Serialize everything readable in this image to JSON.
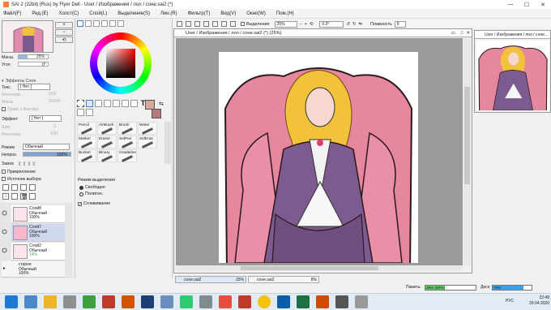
{
  "window": {
    "title": "SAI 2 (32bit) (Rus) by Flyer Dell - User / Изображения / лол / соне.sai2 (*)"
  },
  "menu": [
    "Файл(F)",
    "Ред.(E)",
    "Холст(C)",
    "Слой(L)",
    "Выделение(S)",
    "Лин.(R)",
    "Фильтр(T)",
    "Вид(V)",
    "Окно(W)",
    "Пом.(H)"
  ],
  "toolbar": {
    "selection_label": "Выделение",
    "zoom": "25%",
    "angle": "0.0°",
    "smoothing_label": "Плавность",
    "smoothing_value": "8"
  },
  "navigator": {
    "zoom_label": "Масш.",
    "zoom_value": "25%",
    "angle_label": "Угол",
    "angle_value": "0°"
  },
  "layer_effects": {
    "title": "Эффекты Слоя",
    "texture_label": "Текс.",
    "texture_value": "[ Нет ]",
    "intensity_label": "Интенсив.",
    "intensity_value": "100",
    "scale_label": "Масш.",
    "scale_value": "100%",
    "apply_vector": "Прим. к Вектору",
    "effect_label": "Эффект",
    "effect_value": "[ Нет ]",
    "width_label": "Шир.",
    "width_value": "1",
    "intensity2_label": "Интенсив.",
    "intensity2_value": "100"
  },
  "blend": {
    "mode_label": "Режим",
    "mode_value": "Обычный",
    "opacity_label": "Непроз.",
    "opacity_value": "100%",
    "lock_label": "Замок",
    "clip_label": "Прикрепление",
    "source_label": "Источник выбора"
  },
  "layers": [
    {
      "name": "Слой8",
      "mode": "Обычный",
      "opacity": "100%",
      "selected": false
    },
    {
      "name": "Слой7",
      "mode": "Обычный",
      "opacity": "100%",
      "selected": true
    },
    {
      "name": "Слой2",
      "mode": "Обычный",
      "opacity": "14%",
      "selected": false
    },
    {
      "name": "старое",
      "mode": "Обычный",
      "opacity": "100%",
      "selected": false
    }
  ],
  "tools": [
    "Pencil",
    "AirBrush",
    "Brush",
    "Water",
    "Marker",
    "Eraser",
    "SelPen",
    "SelEras",
    "Bucket",
    "Binary",
    "Gradation"
  ],
  "selection_mode": {
    "title": "Режим выделения",
    "opt1": "Свободно",
    "opt2": "Полигон.",
    "antialias": "Сглаживание"
  },
  "colors": {
    "primary": "#d7a89f",
    "secondary": "#b5787c",
    "accent": "#e6879f"
  },
  "canvas": {
    "title": "User / Изображения / лол / соне.sai2 (*) (25%)"
  },
  "preview": {
    "title": "User / Изображения / лол / соне..."
  },
  "status": {
    "tab1_name": "соне.sai2",
    "tab1_pct": "25%",
    "tab2_name": "соне.sai2",
    "tab2_pct": "8%",
    "mem_label": "Память:",
    "mem_value": "39% (29%)",
    "disk_label": "Диск:",
    "disk_value": "79%"
  },
  "tray": {
    "lang": "РУС",
    "time": "22:48",
    "date": "29.04.2020"
  }
}
